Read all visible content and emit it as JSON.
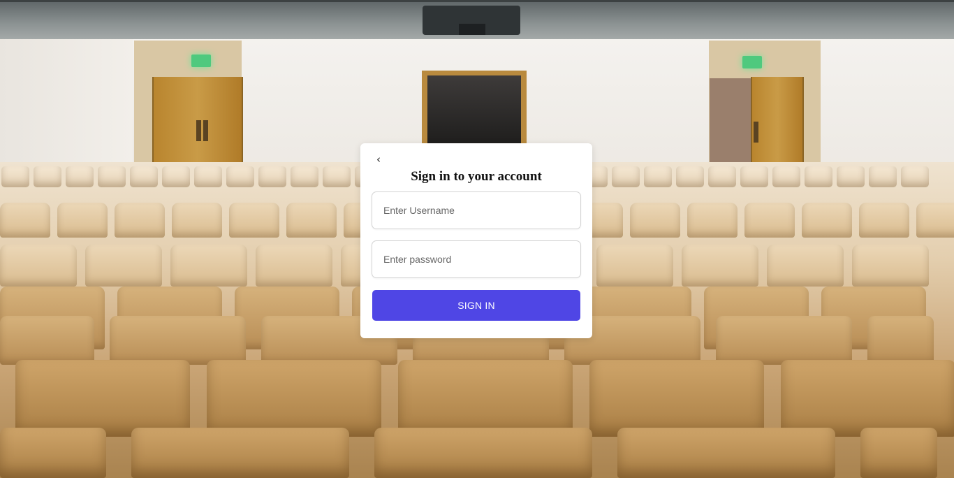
{
  "login": {
    "back_icon": "chevron-left-icon",
    "back_glyph": "‹",
    "title": "Sign in to your account",
    "username": {
      "value": "",
      "placeholder": "Enter Username"
    },
    "password": {
      "value": "",
      "placeholder": "Enter password"
    },
    "submit_label": "SIGN IN"
  },
  "colors": {
    "accent": "#4f46e5",
    "card_background": "#ffffff"
  }
}
